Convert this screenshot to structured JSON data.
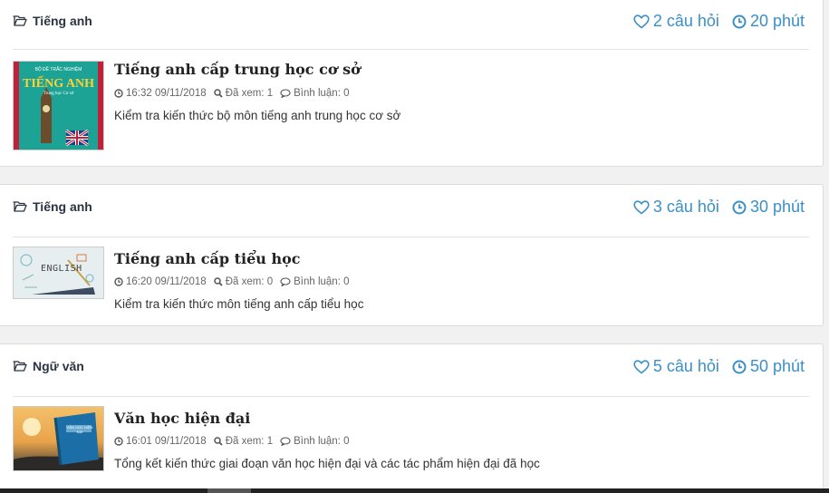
{
  "exams": [
    {
      "category": "Tiếng anh",
      "questions": "2 câu hỏi",
      "duration": "20 phút",
      "title": "Tiếng anh cấp trung học cơ sở",
      "time": "16:32 09/11/2018",
      "views": "Đã xem: 1",
      "comments": "Bình luận: 0",
      "description": "Kiểm tra kiến thức bộ môn tiếng anh trung học cơ sở",
      "thumb": {
        "top_line": "BỘ ĐỀ TRẮC NGHIỆM",
        "title": "TIẾNG ANH",
        "subtitle": "Trung học Cơ sở"
      }
    },
    {
      "category": "Tiếng anh",
      "questions": "3 câu hỏi",
      "duration": "30 phút",
      "title": "Tiếng anh cấp tiểu học",
      "time": "16:20 09/11/2018",
      "views": "Đã xem: 0",
      "comments": "Bình luận: 0",
      "description": "Kiểm tra kiến thức môn tiếng anh cấp tiểu học",
      "thumb": {
        "word": "ENGLISH"
      }
    },
    {
      "category": "Ngữ văn",
      "questions": "5 câu hỏi",
      "duration": "50 phút",
      "title": "Văn học hiện đại",
      "time": "16:01 09/11/2018",
      "views": "Đã xem: 1",
      "comments": "Bình luận: 0",
      "description": "Tổng kết kiến thức giai đoạn văn học hiện đại và các tác phẩm hiện đại đã học",
      "thumb": {
        "book_title": "VĂN HỌC HIỆN ĐẠI"
      }
    }
  ],
  "colors": {
    "accent": "#3a8fc8",
    "title": "#222222",
    "muted": "#666666"
  },
  "icons": {
    "category": "folder-open-icon",
    "questions": "heart-icon",
    "duration": "clock-icon",
    "time": "clock-icon",
    "views": "search-icon",
    "comments": "comment-icon"
  }
}
